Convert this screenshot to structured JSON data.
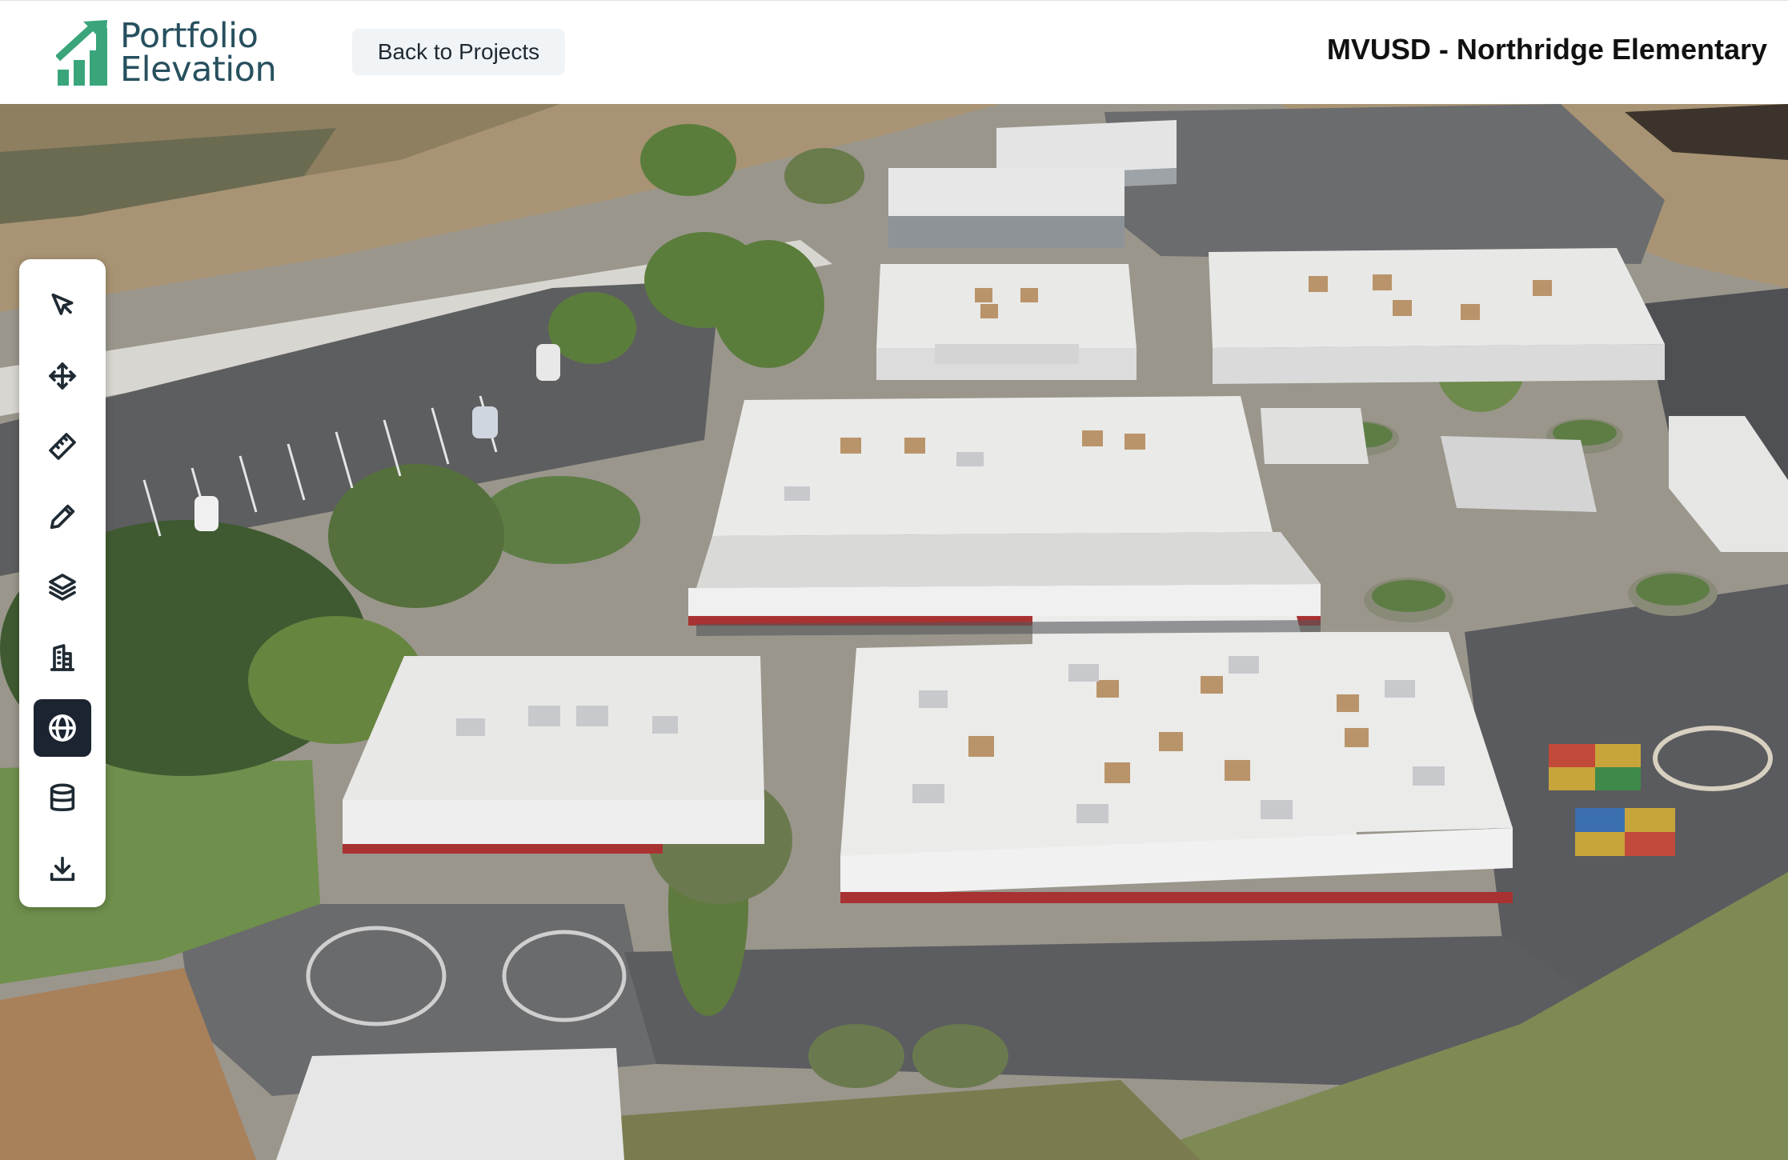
{
  "header": {
    "logo_line1": "Portfolio",
    "logo_line2": "Elevation",
    "back_button_label": "Back to Projects",
    "project_title": "MVUSD - Northridge Elementary"
  },
  "colors": {
    "brand_green": "#3aa57a",
    "brand_text": "#27505e",
    "active_tool_bg": "#1b2430",
    "button_bg": "#f1f4f7"
  },
  "toolbar": {
    "tools": [
      {
        "name": "select-tool",
        "icon": "cursor-arrow-icon",
        "active": false
      },
      {
        "name": "move-tool",
        "icon": "move-arrows-icon",
        "active": false
      },
      {
        "name": "measure-tool",
        "icon": "ruler-icon",
        "active": false
      },
      {
        "name": "draw-tool",
        "icon": "pencil-icon",
        "active": false
      },
      {
        "name": "layers-tool",
        "icon": "layers-icon",
        "active": false
      },
      {
        "name": "buildings-tool",
        "icon": "building-icon",
        "active": false
      },
      {
        "name": "globe-tool",
        "icon": "globe-icon",
        "active": true
      },
      {
        "name": "data-tool",
        "icon": "database-icon",
        "active": false
      },
      {
        "name": "download-tool",
        "icon": "download-icon",
        "active": false
      }
    ]
  }
}
